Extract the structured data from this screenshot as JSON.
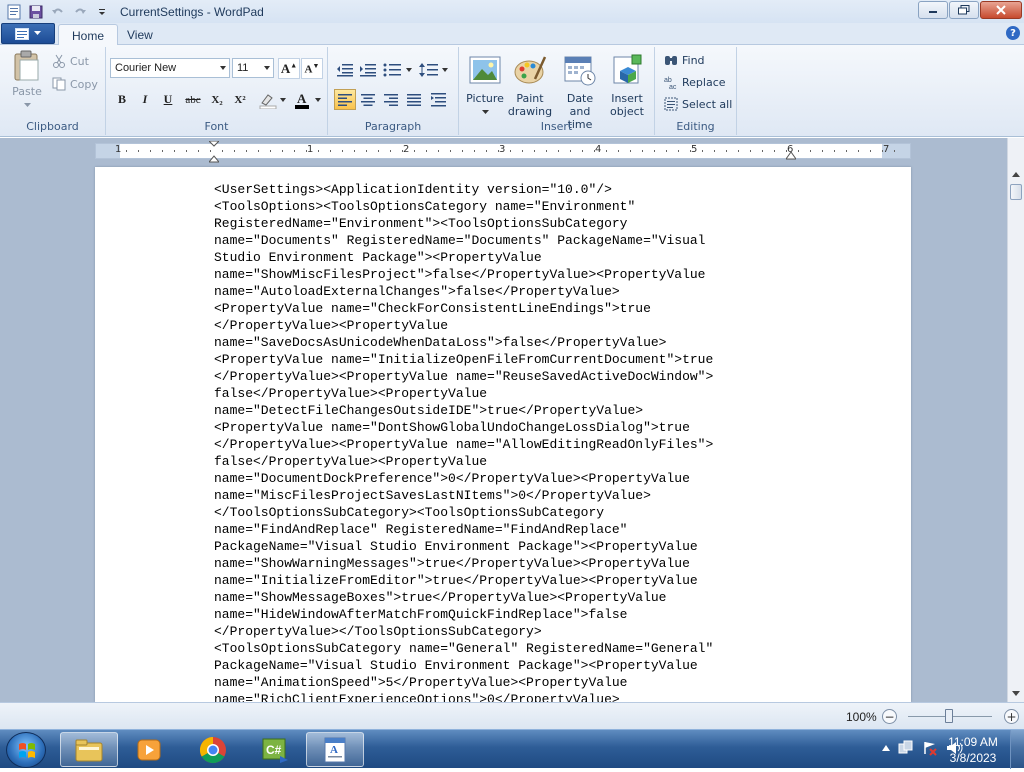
{
  "window": {
    "title": "CurrentSettings - WordPad",
    "minimize_label": "Minimize",
    "maximize_label": "Restore",
    "close_label": "Close"
  },
  "tabs": [
    {
      "label": "Home",
      "active": true
    },
    {
      "label": "View",
      "active": false
    }
  ],
  "help_label": "?",
  "ribbon": {
    "clipboard": {
      "group_label": "Clipboard",
      "paste_label": "Paste",
      "cut_label": "Cut",
      "copy_label": "Copy"
    },
    "font": {
      "group_label": "Font",
      "font_family": "Courier New",
      "font_size": "11",
      "bold": "B",
      "italic": "I",
      "underline": "U",
      "strikethrough": "abc",
      "subscript": "X₂",
      "superscript": "X²"
    },
    "paragraph": {
      "group_label": "Paragraph"
    },
    "insert": {
      "group_label": "Insert",
      "picture_label": "Picture",
      "paint_label_1": "Paint",
      "paint_label_2": "drawing",
      "datetime_label_1": "Date and",
      "datetime_label_2": "time",
      "object_label_1": "Insert",
      "object_label_2": "object"
    },
    "editing": {
      "group_label": "Editing",
      "find_label": "Find",
      "replace_label": "Replace",
      "selectall_label": "Select all"
    }
  },
  "ruler": {
    "numbers": [
      "1",
      "1",
      "2",
      "3",
      "4",
      "5",
      "6",
      "7"
    ]
  },
  "document": {
    "lines": [
      "<UserSettings><ApplicationIdentity version=\"10.0\"/>",
      "<ToolsOptions><ToolsOptionsCategory name=\"Environment\"",
      "RegisteredName=\"Environment\"><ToolsOptionsSubCategory",
      "name=\"Documents\" RegisteredName=\"Documents\" PackageName=\"Visual",
      "Studio Environment Package\"><PropertyValue",
      "name=\"ShowMiscFilesProject\">false</PropertyValue><PropertyValue",
      "name=\"AutoloadExternalChanges\">false</PropertyValue>",
      "<PropertyValue name=\"CheckForConsistentLineEndings\">true",
      "</PropertyValue><PropertyValue",
      "name=\"SaveDocsAsUnicodeWhenDataLoss\">false</PropertyValue>",
      "<PropertyValue name=\"InitializeOpenFileFromCurrentDocument\">true",
      "</PropertyValue><PropertyValue name=\"ReuseSavedActiveDocWindow\">",
      "false</PropertyValue><PropertyValue",
      "name=\"DetectFileChangesOutsideIDE\">true</PropertyValue>",
      "<PropertyValue name=\"DontShowGlobalUndoChangeLossDialog\">true",
      "</PropertyValue><PropertyValue name=\"AllowEditingReadOnlyFiles\">",
      "false</PropertyValue><PropertyValue",
      "name=\"DocumentDockPreference\">0</PropertyValue><PropertyValue",
      "name=\"MiscFilesProjectSavesLastNItems\">0</PropertyValue>",
      "</ToolsOptionsSubCategory><ToolsOptionsSubCategory",
      "name=\"FindAndReplace\" RegisteredName=\"FindAndReplace\"",
      "PackageName=\"Visual Studio Environment Package\"><PropertyValue",
      "name=\"ShowWarningMessages\">true</PropertyValue><PropertyValue",
      "name=\"InitializeFromEditor\">true</PropertyValue><PropertyValue",
      "name=\"ShowMessageBoxes\">true</PropertyValue><PropertyValue",
      "name=\"HideWindowAfterMatchFromQuickFindReplace\">false",
      "</PropertyValue></ToolsOptionsSubCategory>",
      "<ToolsOptionsSubCategory name=\"General\" RegisteredName=\"General\"",
      "PackageName=\"Visual Studio Environment Package\"><PropertyValue",
      "name=\"AnimationSpeed\">5</PropertyValue><PropertyValue",
      "name=\"RichClientExperienceOptions\">0</PropertyValue>"
    ]
  },
  "status": {
    "zoom": "100%",
    "zoom_out": "−",
    "zoom_in": "+"
  },
  "taskbar": {
    "items": [
      "explorer-icon",
      "media-player-icon",
      "chrome-icon",
      "csharp-project-icon",
      "wordpad-icon"
    ],
    "time": "11:09 AM",
    "date": "3/8/2023"
  },
  "colors": {
    "accent": "#2f69c4",
    "taskbar": "#2e5d97",
    "workspace": "#abbbd0"
  }
}
